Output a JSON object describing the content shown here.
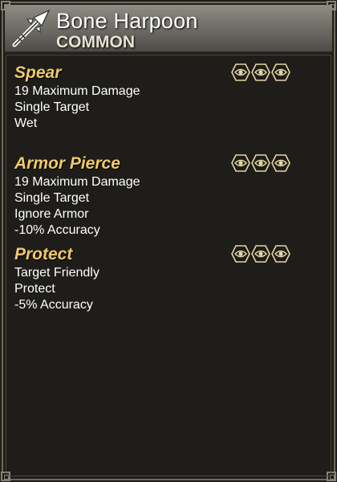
{
  "item": {
    "name": "Bone Harpoon",
    "rarity": "COMMON",
    "icon": "harpoon-icon"
  },
  "skills": [
    {
      "title": "Spear",
      "lines": [
        "19 Maximum Damage",
        "Single Target",
        "Wet"
      ],
      "rank_icons": 3
    },
    {
      "title": "Armor Pierce",
      "lines": [
        "19 Maximum Damage",
        "Single Target",
        "Ignore Armor",
        "-10% Accuracy"
      ],
      "rank_icons": 3
    },
    {
      "title": "Protect",
      "lines": [
        "Target Friendly",
        "Protect",
        "-5% Accuracy"
      ],
      "rank_icons": 3
    }
  ],
  "colors": {
    "skill_title": "#f0c96a",
    "rank_icon": "#e6d7a6",
    "text": "#ffffff"
  }
}
